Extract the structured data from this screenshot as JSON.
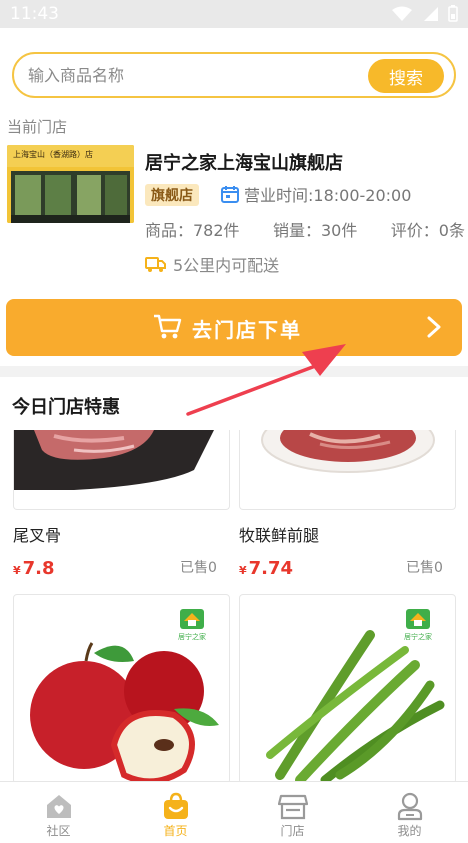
{
  "status_bar": {
    "time": "11:43"
  },
  "search": {
    "placeholder": "输入商品名称",
    "button_label": "搜索"
  },
  "current_store": {
    "section_label": "当前门店",
    "image_sign_text": "上海宝山（香湖路）店",
    "name": "居宁之家上海宝山旗舰店",
    "badge": "旗舰店",
    "hours": "营业时间:18:00-20:00",
    "stats": {
      "products": "商品：782件",
      "sales": "销量：30件",
      "reviews": "评价：0条"
    },
    "delivery": "5公里内可配送"
  },
  "order_button": {
    "label": "去门店下单"
  },
  "deals": {
    "title": "今日门店特惠",
    "products": [
      {
        "name": "尾叉骨",
        "currency": "¥",
        "price": "7.8",
        "sold": "已售0"
      },
      {
        "name": "牧联鲜前腿",
        "currency": "¥",
        "price": "7.74",
        "sold": "已售0"
      },
      {
        "name": "",
        "brand": "居宁之家"
      },
      {
        "name": "",
        "brand": "居宁之家"
      }
    ]
  },
  "tabs": [
    {
      "label": "社区",
      "icon": "community-icon",
      "active": false
    },
    {
      "label": "首页",
      "icon": "shopping-bag-icon",
      "active": true
    },
    {
      "label": "门店",
      "icon": "store-icon",
      "active": false
    },
    {
      "label": "我的",
      "icon": "profile-icon",
      "active": false
    }
  ],
  "colors": {
    "accent": "#f9ab2d",
    "price": "#e8372c",
    "tab_active": "#f5b21a",
    "annotation_arrow": "#ee3f4f"
  }
}
